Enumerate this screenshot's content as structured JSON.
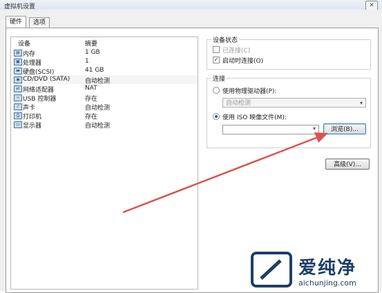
{
  "window": {
    "title": "虚拟机设置",
    "close_label": "✕"
  },
  "tabs": [
    {
      "label": "硬件"
    },
    {
      "label": "选项"
    }
  ],
  "device_list": {
    "col_device": "设备",
    "col_summary": "摘要",
    "rows": [
      {
        "name": "内存",
        "summary": "1 GB",
        "icon": "memory-icon"
      },
      {
        "name": "处理器",
        "summary": "1",
        "icon": "processor-icon"
      },
      {
        "name": "硬盘(SCSI)",
        "summary": "41 GB",
        "icon": "harddisk-icon"
      },
      {
        "name": "CD/DVD (SATA)",
        "summary": "自动检测",
        "icon": "cdrom-icon"
      },
      {
        "name": "网络适配器",
        "summary": "NAT",
        "icon": "network-icon"
      },
      {
        "name": "USB 控制器",
        "summary": "存在",
        "icon": "usb-icon"
      },
      {
        "name": "声卡",
        "summary": "自动检测",
        "icon": "sound-icon"
      },
      {
        "name": "打印机",
        "summary": "存在",
        "icon": "printer-icon"
      },
      {
        "name": "显示器",
        "summary": "自动检测",
        "icon": "monitor-icon"
      }
    ]
  },
  "device_status": {
    "title": "设备状态",
    "connected_label": "已连接(C)",
    "connected_checked": false,
    "power_on_label": "启动时连接(O)",
    "power_on_checked": true
  },
  "connection": {
    "title": "连接",
    "physical_label": "使用物理驱动器(P):",
    "physical_value": "自动检测",
    "iso_label": "使用 ISO 映像文件(M):",
    "iso_selected": true,
    "iso_value": "",
    "browse_label": "浏览(B)...",
    "advanced_label": "高级(V)..."
  },
  "watermark": {
    "text": "爱纯净",
    "url": "aichunjing.com"
  },
  "colors": {
    "arrow": "#d9534f",
    "accent": "#3c7fb1"
  }
}
